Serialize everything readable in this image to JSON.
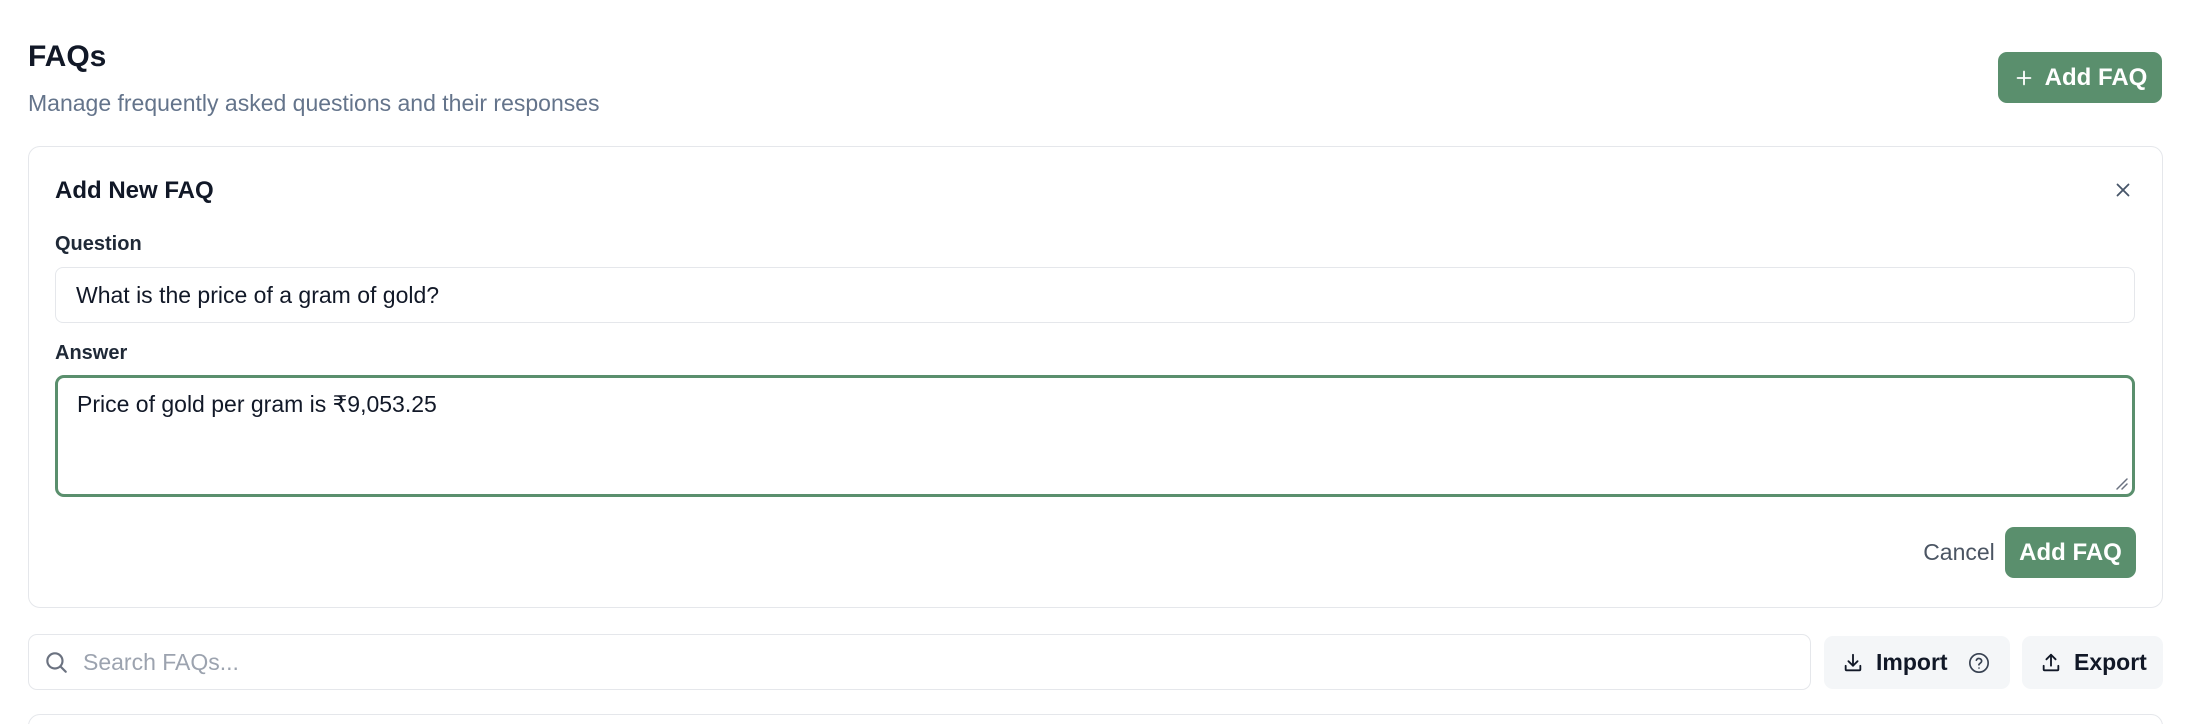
{
  "header": {
    "title": "FAQs",
    "subtitle": "Manage frequently asked questions and their responses",
    "add_button_label": "Add FAQ"
  },
  "form": {
    "title": "Add New FAQ",
    "question_label": "Question",
    "question_value": "What is the price of a gram of gold?",
    "answer_label": "Answer",
    "answer_value": "Price of gold per gram is ₹9,053.25",
    "cancel_label": "Cancel",
    "submit_label": "Add FAQ"
  },
  "toolbar": {
    "search_placeholder": "Search FAQs...",
    "import_label": "Import",
    "export_label": "Export"
  },
  "colors": {
    "accent": "#5a8f6d",
    "muted_text": "#64748b",
    "border": "#e5e7eb"
  },
  "icons": [
    "plus-icon",
    "close-icon",
    "search-icon",
    "download-icon",
    "help-circle-icon",
    "upload-icon",
    "resize-grip-icon"
  ]
}
